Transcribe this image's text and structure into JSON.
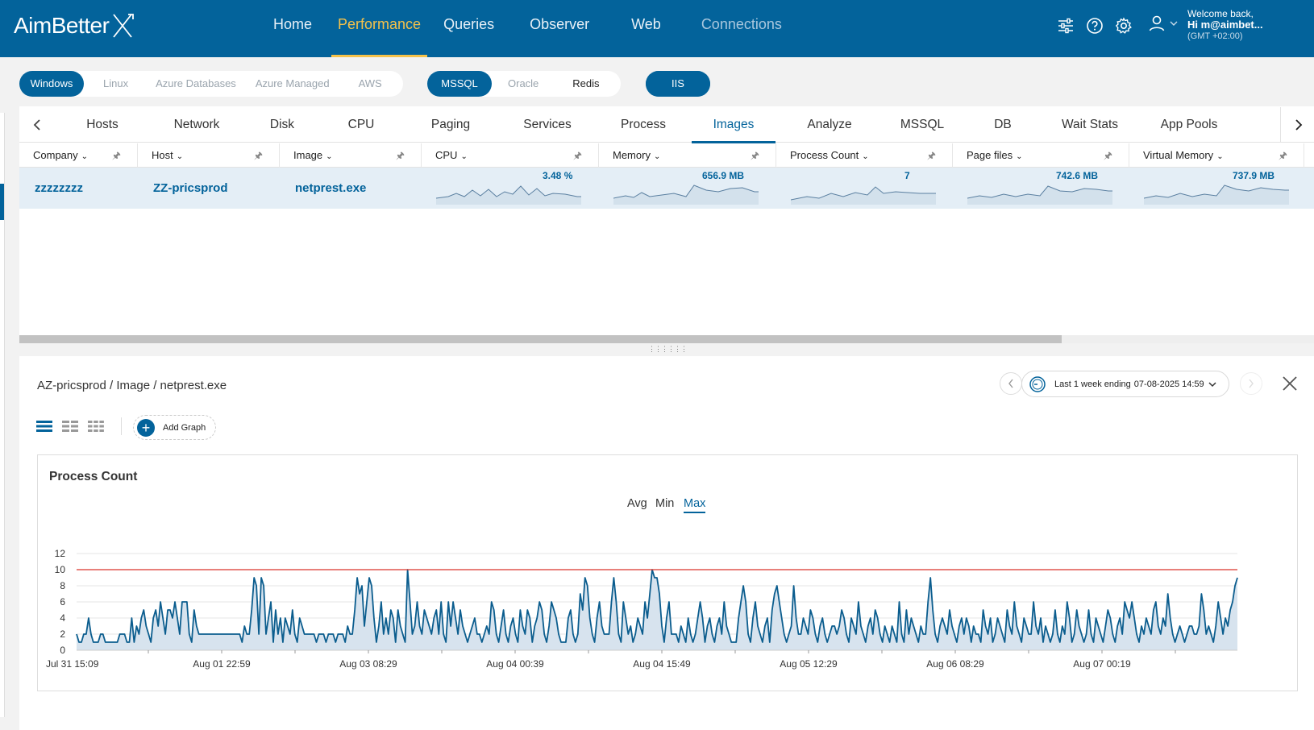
{
  "app": {
    "logo_text": "AimBetter"
  },
  "nav": {
    "items": [
      {
        "label": "Home",
        "state": "normal"
      },
      {
        "label": "Performance",
        "state": "active"
      },
      {
        "label": "Queries",
        "state": "normal"
      },
      {
        "label": "Observer",
        "state": "normal"
      },
      {
        "label": "Web",
        "state": "normal"
      },
      {
        "label": "Connections",
        "state": "dim"
      }
    ]
  },
  "user": {
    "welcome": "Welcome back,",
    "name": "Hi m@aimbet...",
    "timezone": "(GMT +02:00)"
  },
  "platforms": [
    "Windows",
    "Linux",
    "Azure Databases",
    "Azure Managed",
    "AWS"
  ],
  "databases": [
    "MSSQL",
    "Oracle",
    "Redis"
  ],
  "servers": [
    "IIS"
  ],
  "tabs": [
    "Hosts",
    "Network",
    "Disk",
    "CPU",
    "Paging",
    "Services",
    "Process",
    "Images",
    "Analyze",
    "MSSQL",
    "DB",
    "Wait Stats",
    "App Pools"
  ],
  "active_tab": "Images",
  "columns": [
    "Company",
    "Host",
    "Image",
    "CPU",
    "Memory",
    "Process Count",
    "Page files",
    "Virtual Memory"
  ],
  "row": {
    "company": "zzzzzzzz",
    "host": "ZZ-pricsprod",
    "image": "netprest.exe",
    "cpu": "3.48 %",
    "memory": "656.9 MB",
    "process_count": "7",
    "page_files": "742.6 MB",
    "virtual_memory": "737.9 MB"
  },
  "detail": {
    "breadcrumb": "AZ-pricsprod / Image / netprest.exe",
    "range_label": "Last 1 week ending",
    "range_end": "07-08-2025 14:59",
    "add_graph": "Add Graph"
  },
  "chart_data": {
    "type": "line",
    "title": "Process Count",
    "aggregations": [
      "Avg",
      "Min",
      "Max"
    ],
    "selected_aggregation": "Max",
    "ylim": [
      0,
      12
    ],
    "yticks": [
      0,
      2,
      4,
      6,
      8,
      10,
      12
    ],
    "threshold": 10,
    "threshold_color": "#d9342b",
    "series_color": "#0b5d8e",
    "fill_color": "#d7e3ee",
    "grid": true,
    "x_labels": [
      "Jul 31 15:09",
      "Aug 01 22:59",
      "Aug 03 08:29",
      "Aug 04 00:39",
      "Aug 04 15:49",
      "Aug 05 12:29",
      "Aug 06 08:29",
      "Aug 07 00:19"
    ],
    "values": [
      2,
      1,
      1,
      2,
      2,
      4,
      2,
      1,
      1,
      1,
      2,
      2,
      1,
      1,
      1,
      1,
      1,
      1,
      2,
      2,
      2,
      1,
      1,
      4,
      1,
      3,
      2,
      4,
      5,
      3,
      2,
      1,
      4,
      5,
      3,
      6,
      4,
      2,
      5,
      5,
      4,
      6,
      4,
      2,
      6,
      6,
      6,
      2,
      1,
      5,
      3,
      2,
      2,
      2,
      2,
      2,
      2,
      2,
      2,
      2,
      2,
      2,
      2,
      2,
      2,
      2,
      2,
      2,
      2,
      1,
      3,
      2,
      2,
      5,
      9,
      8,
      2,
      9,
      8,
      2,
      4,
      6,
      1,
      5,
      2,
      4,
      1,
      4,
      3,
      2,
      5,
      2,
      1,
      4,
      3,
      2,
      2,
      2,
      2,
      2,
      1,
      2,
      2,
      2,
      1,
      2,
      2,
      2,
      1,
      2,
      2,
      2,
      1,
      3,
      2,
      2,
      5,
      9,
      7,
      8,
      3,
      6,
      9,
      8,
      4,
      1,
      3,
      6,
      2,
      4,
      2,
      5,
      4,
      1,
      5,
      3,
      2,
      1,
      10,
      6,
      2,
      3,
      6,
      3,
      2,
      5,
      4,
      3,
      2,
      4,
      5,
      2,
      6,
      2,
      1,
      6,
      3,
      6,
      4,
      2,
      5,
      3,
      2,
      1,
      2,
      3,
      4,
      2,
      2,
      1,
      2,
      3,
      2,
      6,
      5,
      2,
      1,
      3,
      5,
      2,
      1,
      3,
      4,
      2,
      1,
      5,
      3,
      2,
      5,
      4,
      1,
      3,
      4,
      6,
      5,
      2,
      1,
      3,
      6,
      5,
      4,
      2,
      1,
      1,
      1,
      4,
      5,
      2,
      1,
      2,
      7,
      5,
      9,
      8,
      4,
      2,
      1,
      4,
      6,
      3,
      2,
      2,
      2,
      6,
      9,
      6,
      2,
      1,
      6,
      4,
      2,
      3,
      1,
      2,
      4,
      3,
      2,
      6,
      4,
      7,
      10,
      9,
      9,
      7,
      3,
      1,
      4,
      6,
      2,
      2,
      2,
      1,
      3,
      2,
      1,
      4,
      2,
      1,
      2,
      4,
      6,
      4,
      1,
      3,
      4,
      2,
      1,
      3,
      4,
      2,
      6,
      3,
      2,
      1,
      1,
      1,
      4,
      6,
      8,
      6,
      2,
      1,
      4,
      6,
      3,
      2,
      1,
      3,
      4,
      1,
      5,
      7,
      8,
      6,
      4,
      2,
      1,
      2,
      3,
      8,
      4,
      2,
      2,
      4,
      3,
      2,
      5,
      4,
      2,
      1,
      3,
      4,
      2,
      1,
      2,
      3,
      3,
      2,
      3,
      5,
      4,
      2,
      1,
      4,
      3,
      2,
      6,
      3,
      2,
      1,
      3,
      4,
      2,
      5,
      4,
      2,
      1,
      3,
      2,
      1,
      3,
      2,
      1,
      6,
      2,
      1,
      5,
      2,
      4,
      3,
      2,
      1,
      3,
      2,
      2,
      6,
      9,
      5,
      2,
      1,
      3,
      4,
      3,
      2,
      5,
      3,
      2,
      1,
      3,
      4,
      2,
      4,
      3,
      1,
      3,
      2,
      2,
      1,
      5,
      3,
      2,
      4,
      1,
      2,
      4,
      3,
      2,
      1,
      5,
      3,
      2,
      6,
      3,
      2,
      1,
      4,
      3,
      2,
      2,
      6,
      3,
      2,
      4,
      1,
      3,
      2,
      1,
      2,
      5,
      2,
      1,
      3,
      2,
      6,
      4,
      1,
      2,
      5,
      3,
      2,
      1,
      2,
      5,
      2,
      1,
      4,
      3,
      2,
      1,
      3,
      5,
      4,
      2,
      1,
      3,
      4,
      2,
      6,
      5,
      4,
      6,
      4,
      2,
      1,
      3,
      2,
      4,
      3,
      2,
      5,
      6,
      3,
      2,
      4,
      3,
      7,
      4,
      2,
      1,
      2,
      3,
      2,
      1,
      2,
      3,
      3,
      2,
      2,
      3,
      7,
      5,
      2,
      3,
      2,
      1,
      3,
      6,
      4,
      2,
      4,
      3,
      5,
      6,
      8,
      9
    ]
  }
}
